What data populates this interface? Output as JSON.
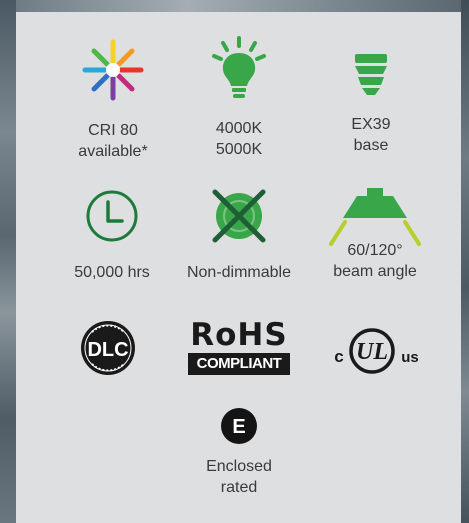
{
  "features": {
    "cri": {
      "line1": "CRI 80",
      "line2": "available*",
      "icon": "color-spectrum-icon"
    },
    "cct": {
      "line1": "4000K",
      "line2": "5000K",
      "icon": "lightbulb-icon"
    },
    "base": {
      "line1": "EX39",
      "line2": "base",
      "icon": "lamp-base-icon"
    },
    "life": {
      "line1": "50,000 hrs",
      "icon": "clock-icon"
    },
    "dim": {
      "line1": "Non-dimmable",
      "icon": "non-dimmable-icon"
    },
    "beam": {
      "line1": "60/120°",
      "line2": "beam angle",
      "icon": "beam-angle-icon"
    },
    "enclosed": {
      "line1": "Enclosed",
      "line2": "rated",
      "icon": "enclosed-rated-icon",
      "badge": "E"
    }
  },
  "certifications": {
    "dlc": {
      "text": "DLC",
      "icon": "dlc-logo"
    },
    "rohs": {
      "line1": "RoHS",
      "line2": "COMPLIANT",
      "icon": "rohs-logo"
    },
    "ul": {
      "left": "c",
      "mark": "UL",
      "right": "us",
      "icon": "cul-us-logo"
    }
  },
  "colors": {
    "green": "#3aa64a",
    "dark_green": "#1e7a3a",
    "panel": "#dedfe0",
    "text": "#3a3a3a"
  }
}
